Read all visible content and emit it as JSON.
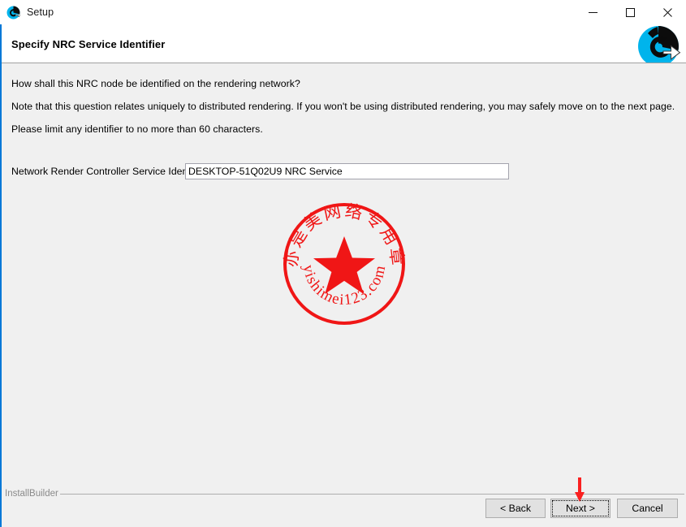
{
  "window": {
    "title": "Setup",
    "icon": "installer-swirl-icon",
    "accent_color": "#0078d7",
    "controls": {
      "minimize": "minimize-icon",
      "maximize": "maximize-icon",
      "close": "close-icon"
    }
  },
  "header": {
    "title": "Specify NRC Service Identifier",
    "logo": "product-swirl-download-logo"
  },
  "body": {
    "paragraph_1": "How shall this NRC node be identified on the rendering network?",
    "paragraph_2": "Note that this question relates uniquely to distributed rendering.  If you won't be using distributed rendering, you may safely move on to the next page.",
    "paragraph_3": "Please limit any identifier to no more than 60 characters.",
    "field": {
      "label": "Network Render Controller Service Identifier",
      "value": "DESKTOP-51Q02U9 NRC Service",
      "placeholder": ""
    }
  },
  "watermark": {
    "top_arc_text": "亦是美网络专用章",
    "bottom_arc_text": "yishimei123.com",
    "color": "#f01616",
    "shape": "circular-stamp-with-star"
  },
  "footer": {
    "brand": "InstallBuilder",
    "buttons": {
      "back": "< Back",
      "next": "Next >",
      "cancel": "Cancel"
    }
  },
  "annotation": {
    "arrow": "red-down-arrow",
    "color": "#fa2020",
    "points_at": "Next >"
  }
}
